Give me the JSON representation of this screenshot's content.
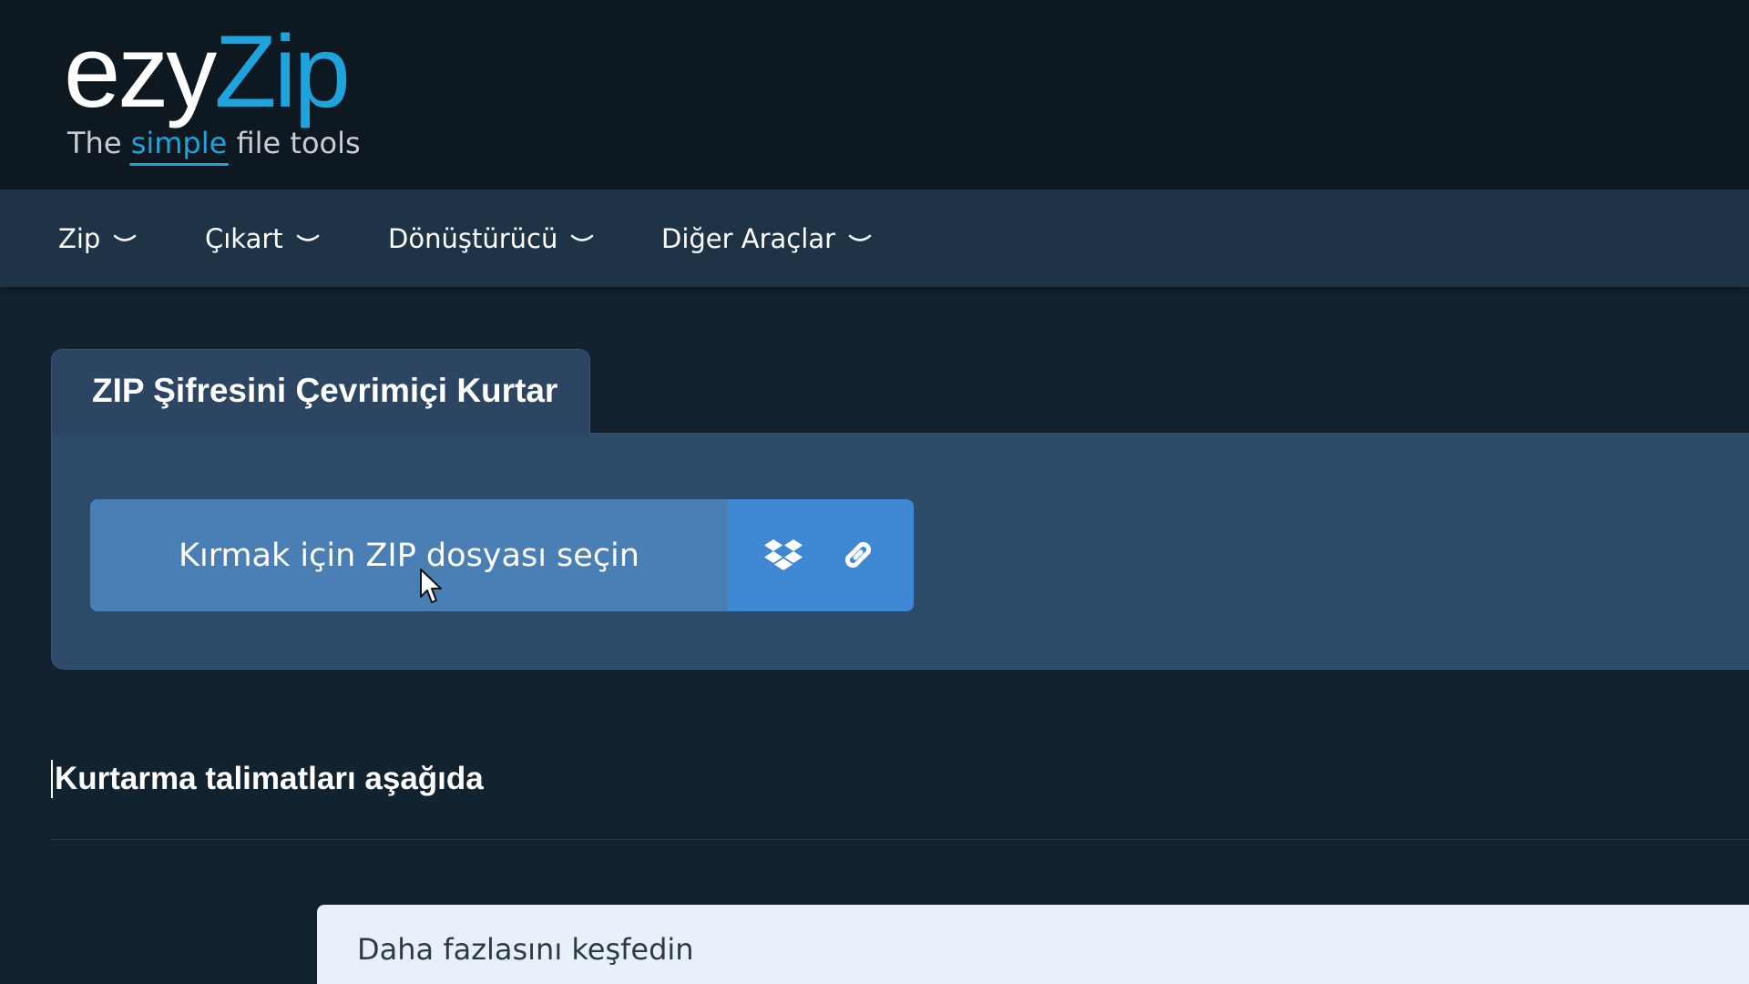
{
  "logo": {
    "part1": "ezy",
    "part2": "Zip",
    "tagline_before": "The ",
    "tagline_accent": "simple",
    "tagline_after": " file tools"
  },
  "nav": {
    "items": [
      {
        "label": "Zip"
      },
      {
        "label": "Çıkart"
      },
      {
        "label": "Dönüştürücü"
      },
      {
        "label": "Diğer Araçlar"
      }
    ]
  },
  "card": {
    "title": "ZIP Şifresini Çevrimiçi Kurtar",
    "select_label": "Kırmak için ZIP dosyası seçin",
    "addons": [
      {
        "icon": "dropbox-icon"
      },
      {
        "icon": "link-icon"
      }
    ]
  },
  "instructions": {
    "heading": "Kurtarma talimatları aşağıda"
  },
  "more": {
    "title": "Daha fazlasını keşfedin"
  },
  "colors": {
    "accent": "#1fa3dc",
    "header_bg": "#0d1821",
    "nav_bg": "#1f3347",
    "page_bg": "#13222f",
    "button": "#4a7fb6",
    "addon": "#3f86d3",
    "panel_bg": "#e8f0fc"
  }
}
